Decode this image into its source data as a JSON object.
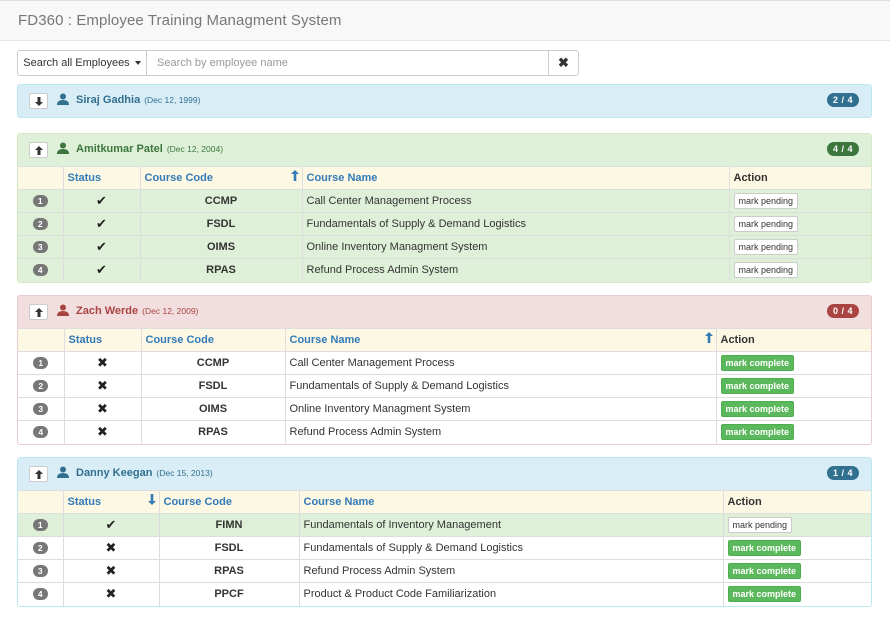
{
  "app": {
    "title": "FD360 : Employee Training Managment System"
  },
  "search": {
    "dropdown_label": "Search all Employees",
    "placeholder": "Search by employee name"
  },
  "colors": {
    "info": "#31708f",
    "success": "#3c763d",
    "danger": "#a94442",
    "badge_info": "#31708f",
    "badge_success": "#3c763d",
    "badge_danger": "#a94442"
  },
  "headers": {
    "status": "Status",
    "course_code": "Course Code",
    "course_name": "Course Name",
    "action": "Action"
  },
  "employees": [
    {
      "name": "Siraj Gadhia",
      "date": "(Dec 12, 1999)",
      "badge": "2 / 4",
      "toggle_icon": "arrow-down-icon",
      "courses": []
    },
    {
      "name": "Amitkumar Patel",
      "date": "(Dec 12, 2004)",
      "badge": "4 / 4",
      "toggle_icon": "arrow-up-icon",
      "sort_column": "course_code",
      "courses": [
        {
          "num": "1",
          "status": "✔",
          "code": "CCMP",
          "name": "Call Center Management Process",
          "action": "mark pending",
          "done": true
        },
        {
          "num": "2",
          "status": "✔",
          "code": "FSDL",
          "name": "Fundamentals of Supply & Demand Logistics",
          "action": "mark pending",
          "done": true
        },
        {
          "num": "3",
          "status": "✔",
          "code": "OIMS",
          "name": "Online Inventory Managment System",
          "action": "mark pending",
          "done": true
        },
        {
          "num": "4",
          "status": "✔",
          "code": "RPAS",
          "name": "Refund Process Admin System",
          "action": "mark pending",
          "done": true
        }
      ]
    },
    {
      "name": "Zach Werde",
      "date": "(Dec 12, 2009)",
      "badge": "0 / 4",
      "toggle_icon": "arrow-up-icon",
      "sort_column": "course_name",
      "courses": [
        {
          "num": "1",
          "status": "✖",
          "code": "CCMP",
          "name": "Call Center Management Process",
          "action": "mark complete",
          "done": false
        },
        {
          "num": "2",
          "status": "✖",
          "code": "FSDL",
          "name": "Fundamentals of Supply & Demand Logistics",
          "action": "mark complete",
          "done": false
        },
        {
          "num": "3",
          "status": "✖",
          "code": "OIMS",
          "name": "Online Inventory Managment System",
          "action": "mark complete",
          "done": false
        },
        {
          "num": "4",
          "status": "✖",
          "code": "RPAS",
          "name": "Refund Process Admin System",
          "action": "mark complete",
          "done": false
        }
      ]
    },
    {
      "name": "Danny Keegan",
      "date": "(Dec 15, 2013)",
      "badge": "1 / 4",
      "toggle_icon": "arrow-up-icon",
      "sort_column": "status",
      "courses": [
        {
          "num": "1",
          "status": "✔",
          "code": "FIMN",
          "name": "Fundamentals of Inventory Management",
          "action": "mark pending",
          "done": true
        },
        {
          "num": "2",
          "status": "✖",
          "code": "FSDL",
          "name": "Fundamentals of Supply & Demand Logistics",
          "action": "mark complete",
          "done": false
        },
        {
          "num": "3",
          "status": "✖",
          "code": "RPAS",
          "name": "Refund Process Admin System",
          "action": "mark complete",
          "done": false
        },
        {
          "num": "4",
          "status": "✖",
          "code": "PPCF",
          "name": "Product & Product Code Familiarization",
          "action": "mark complete",
          "done": false
        }
      ]
    }
  ]
}
